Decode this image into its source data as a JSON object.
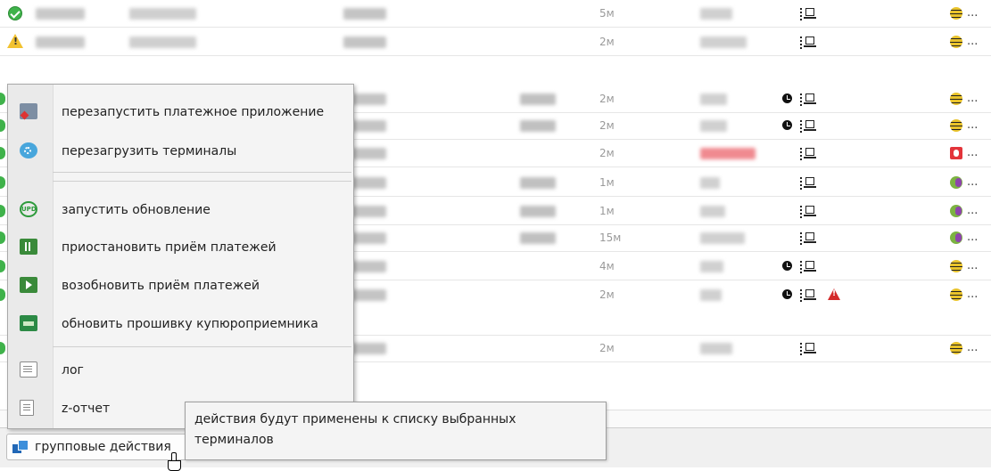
{
  "rows": [
    {
      "status": "ok",
      "age": "5м",
      "clock": false,
      "alert": false,
      "operator": "beeline"
    },
    {
      "status": "warning",
      "age": "2м",
      "clock": false,
      "alert": false,
      "operator": "beeline"
    },
    {
      "status": "partial",
      "age": "2м",
      "clock": true,
      "alert": false,
      "operator": "beeline"
    },
    {
      "status": "partial",
      "age": "2м",
      "clock": true,
      "alert": false,
      "operator": "beeline"
    },
    {
      "status": "partial",
      "age": "2м",
      "clock": false,
      "alert": false,
      "operator": "mts"
    },
    {
      "status": "partial",
      "age": "1м",
      "clock": false,
      "alert": false,
      "operator": "megafon"
    },
    {
      "status": "partial",
      "age": "1м",
      "clock": false,
      "alert": false,
      "operator": "megafon"
    },
    {
      "status": "partial",
      "age": "15м",
      "clock": false,
      "alert": false,
      "operator": "megafon"
    },
    {
      "status": "partial",
      "age": "4м",
      "clock": true,
      "alert": false,
      "operator": "beeline"
    },
    {
      "status": "partial",
      "age": "2м",
      "clock": true,
      "alert": true,
      "operator": "beeline"
    },
    {
      "status": "partial",
      "age": "2м",
      "clock": false,
      "alert": false,
      "operator": "beeline"
    }
  ],
  "ellipsis": "...",
  "context_menu": {
    "items": [
      {
        "icon": "restart-app-icon",
        "label": "перезапустить платежное приложение"
      },
      {
        "icon": "reload-terminals-icon",
        "label": "перезагрузить терминалы"
      },
      {
        "icon": "update-icon",
        "label": "запустить обновление"
      },
      {
        "icon": "pause-payments-icon",
        "label": "приостановить приём платежей"
      },
      {
        "icon": "resume-payments-icon",
        "label": "возобновить приём платежей"
      },
      {
        "icon": "firmware-icon",
        "label": "обновить прошивку купюроприемника"
      },
      {
        "icon": "log-icon",
        "label": "лог"
      },
      {
        "icon": "report-icon",
        "label": "z-отчет"
      }
    ]
  },
  "group_actions_button": {
    "label": "групповые действия"
  },
  "tooltip": {
    "text": "действия будут применены к списку выбранных терминалов"
  },
  "colors": {
    "ok": "#3fb24a",
    "warning": "#f2c230",
    "alert": "#d42a2a",
    "accent": "#2167b6"
  }
}
